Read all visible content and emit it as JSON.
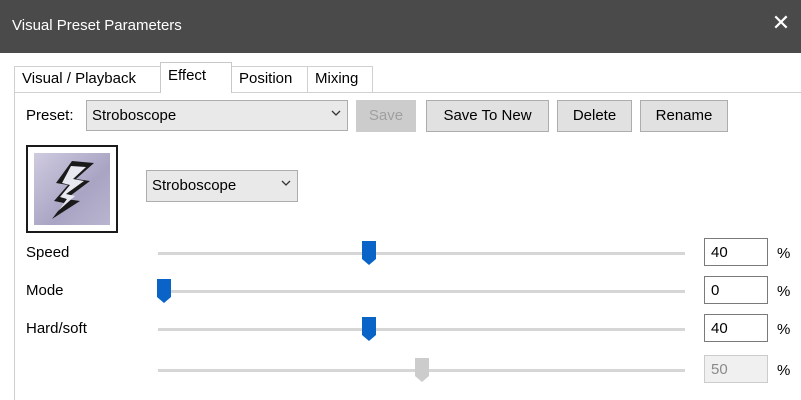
{
  "window": {
    "title": "Visual Preset Parameters",
    "close_glyph": "✕"
  },
  "tabs": [
    {
      "label": "Visual / Playback",
      "active": false
    },
    {
      "label": "Effect",
      "active": true
    },
    {
      "label": "Position",
      "active": false
    },
    {
      "label": "Mixing",
      "active": false
    }
  ],
  "preset": {
    "label": "Preset:",
    "selected": "Stroboscope",
    "buttons": {
      "save": "Save",
      "save_to_new": "Save To New",
      "delete": "Delete",
      "rename": "Rename"
    }
  },
  "effect": {
    "icon": "lightning-bolt-icon",
    "selected": "Stroboscope"
  },
  "params": [
    {
      "label": "Speed",
      "value": "40",
      "level": 0.4,
      "unit": "%",
      "enabled": true
    },
    {
      "label": "Mode",
      "value": "0",
      "level": 0.0,
      "unit": "%",
      "enabled": true
    },
    {
      "label": "Hard/soft",
      "value": "40",
      "level": 0.4,
      "unit": "%",
      "enabled": true
    },
    {
      "label": "",
      "value": "50",
      "level": 0.5,
      "unit": "%",
      "enabled": false
    }
  ],
  "colors": {
    "titlebar": "#4a4a4a",
    "thumb": "#0a64c8",
    "thumb_disabled": "#cccccc"
  }
}
